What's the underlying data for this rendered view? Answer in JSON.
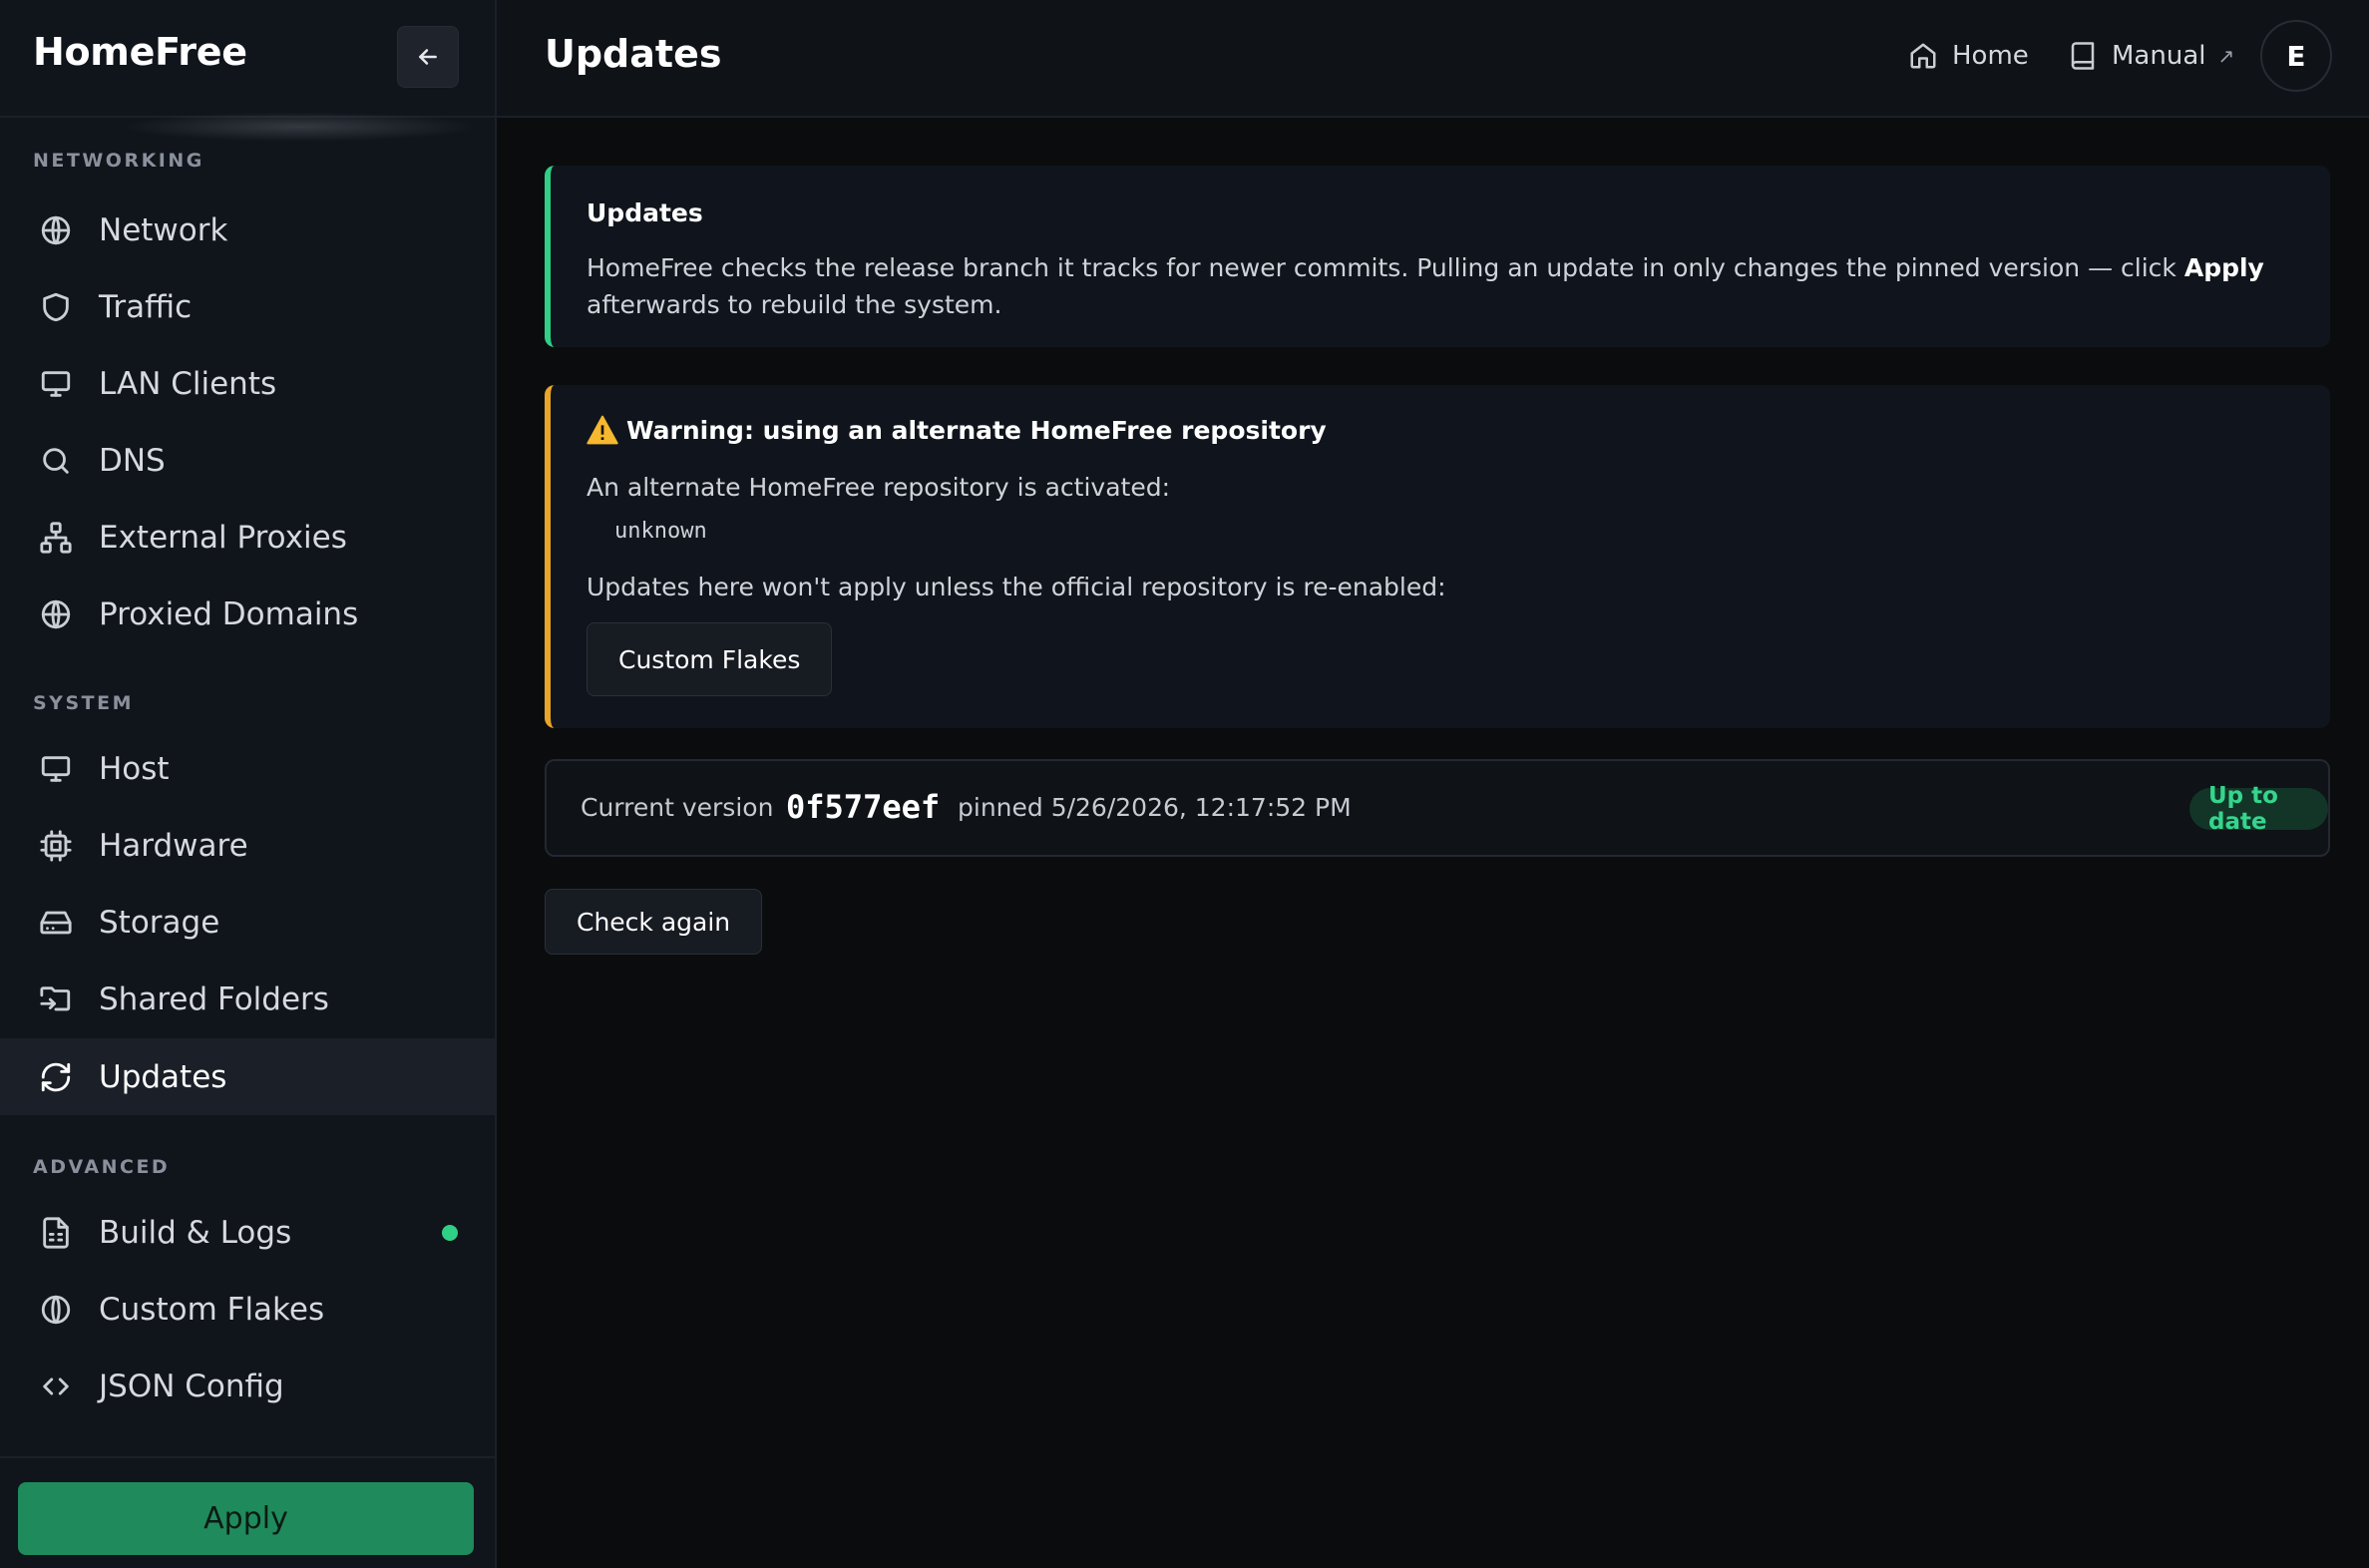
{
  "app": {
    "brand": "HomeFree"
  },
  "sidebar": {
    "sections": [
      {
        "label": "NETWORKING",
        "items": [
          {
            "label": "Network",
            "icon": "globe-icon"
          },
          {
            "label": "Traffic",
            "icon": "shield-icon"
          },
          {
            "label": "LAN Clients",
            "icon": "monitor-icon"
          },
          {
            "label": "DNS",
            "icon": "search-icon"
          },
          {
            "label": "External Proxies",
            "icon": "network-icon"
          },
          {
            "label": "Proxied Domains",
            "icon": "globe-icon"
          }
        ]
      },
      {
        "label": "SYSTEM",
        "items": [
          {
            "label": "Host",
            "icon": "monitor-icon"
          },
          {
            "label": "Hardware",
            "icon": "cpu-icon"
          },
          {
            "label": "Storage",
            "icon": "hard-drive-icon"
          },
          {
            "label": "Shared Folders",
            "icon": "folder-input-icon"
          },
          {
            "label": "Updates",
            "icon": "refresh-icon",
            "active": true
          }
        ]
      },
      {
        "label": "ADVANCED",
        "items": [
          {
            "label": "Build & Logs",
            "icon": "file-text-icon",
            "status_dot": true
          },
          {
            "label": "Custom Flakes",
            "icon": "snowflake-icon"
          },
          {
            "label": "JSON Config",
            "icon": "code-icon"
          }
        ]
      }
    ],
    "apply_label": "Apply"
  },
  "header": {
    "title": "Updates",
    "home_label": "Home",
    "manual_label": "Manual",
    "avatar_initial": "E"
  },
  "info_card": {
    "title": "Updates",
    "body_prefix": "HomeFree checks the release branch it tracks for newer commits. Pulling an update in only changes the pinned version — click ",
    "body_bold": "Apply",
    "body_suffix": " afterwards to rebuild the system."
  },
  "warning_card": {
    "title": "Warning: using an alternate HomeFree repository",
    "line1": "An alternate HomeFree repository is activated:",
    "repo": "unknown",
    "line2": "Updates here won't apply unless the official repository is re-enabled:",
    "button_label": "Custom Flakes"
  },
  "version": {
    "label": "Current version",
    "hash": "0f577eef",
    "pinned": "pinned 5/26/2026, 12:17:52 PM",
    "status": "Up to date"
  },
  "check_again_label": "Check again",
  "colors": {
    "accent_green": "#2fcf86",
    "warning_amber": "#e8a52a",
    "apply_green": "#1f8a5c"
  }
}
